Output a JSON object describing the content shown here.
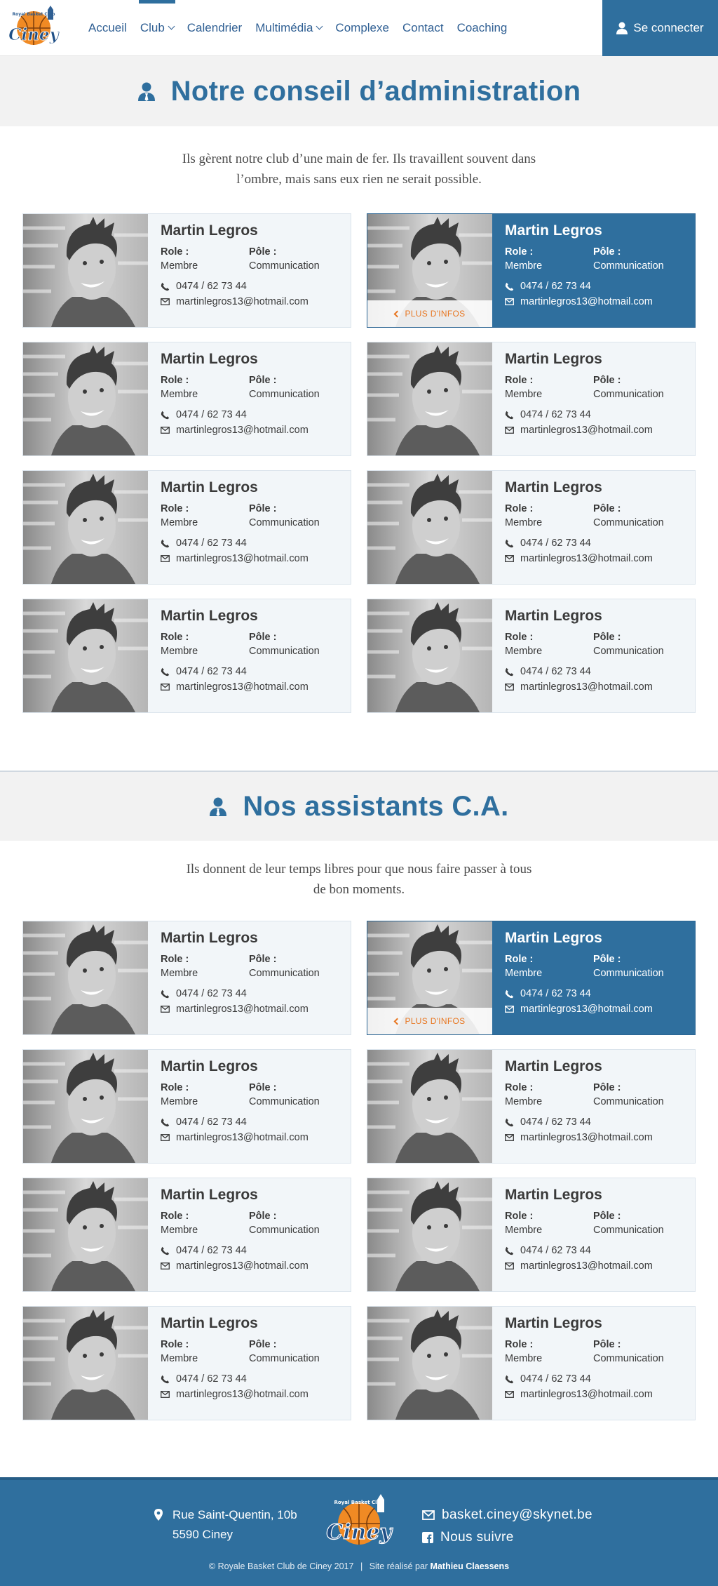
{
  "brand": {
    "logo_script": "Ciney",
    "logo_arc": "Royal Basket Club"
  },
  "nav": {
    "items": [
      {
        "label": "Accueil",
        "dropdown": false,
        "active": false
      },
      {
        "label": "Club",
        "dropdown": true,
        "active": true
      },
      {
        "label": "Calendrier",
        "dropdown": false,
        "active": false
      },
      {
        "label": "Multimédia",
        "dropdown": true,
        "active": false
      },
      {
        "label": "Complexe",
        "dropdown": false,
        "active": false
      },
      {
        "label": "Contact",
        "dropdown": false,
        "active": false
      },
      {
        "label": "Coaching",
        "dropdown": false,
        "active": false
      }
    ],
    "login_label": "Se connecter"
  },
  "sections": [
    {
      "title": "Notre conseil d’administration",
      "intro_line1": "Ils gèrent notre club d’une main de fer. Ils travaillent souvent dans",
      "intro_line2": "l’ombre, mais sans eux rien ne serait possible.",
      "members": [
        {
          "name": "Martin Legros",
          "role": "Membre",
          "pole": "Communication",
          "phone": "0474 / 62 73 44",
          "email": "martinlegros13@hotmail.com",
          "highlighted": false
        },
        {
          "name": "Martin Legros",
          "role": "Membre",
          "pole": "Communication",
          "phone": "0474 / 62 73 44",
          "email": "martinlegros13@hotmail.com",
          "highlighted": true
        },
        {
          "name": "Martin Legros",
          "role": "Membre",
          "pole": "Communication",
          "phone": "0474 / 62 73 44",
          "email": "martinlegros13@hotmail.com",
          "highlighted": false
        },
        {
          "name": "Martin Legros",
          "role": "Membre",
          "pole": "Communication",
          "phone": "0474 / 62 73 44",
          "email": "martinlegros13@hotmail.com",
          "highlighted": false
        },
        {
          "name": "Martin Legros",
          "role": "Membre",
          "pole": "Communication",
          "phone": "0474 / 62 73 44",
          "email": "martinlegros13@hotmail.com",
          "highlighted": false
        },
        {
          "name": "Martin Legros",
          "role": "Membre",
          "pole": "Communication",
          "phone": "0474 / 62 73 44",
          "email": "martinlegros13@hotmail.com",
          "highlighted": false
        },
        {
          "name": "Martin Legros",
          "role": "Membre",
          "pole": "Communication",
          "phone": "0474 / 62 73 44",
          "email": "martinlegros13@hotmail.com",
          "highlighted": false
        },
        {
          "name": "Martin Legros",
          "role": "Membre",
          "pole": "Communication",
          "phone": "0474 / 62 73 44",
          "email": "martinlegros13@hotmail.com",
          "highlighted": false
        }
      ]
    },
    {
      "title": "Nos assistants C.A.",
      "intro_line1": "Ils donnent de leur temps libres pour que nous faire passer à  tous",
      "intro_line2": "de bon moments.",
      "members": [
        {
          "name": "Martin Legros",
          "role": "Membre",
          "pole": "Communication",
          "phone": "0474 / 62 73 44",
          "email": "martinlegros13@hotmail.com",
          "highlighted": false
        },
        {
          "name": "Martin Legros",
          "role": "Membre",
          "pole": "Communication",
          "phone": "0474 / 62 73 44",
          "email": "martinlegros13@hotmail.com",
          "highlighted": true
        },
        {
          "name": "Martin Legros",
          "role": "Membre",
          "pole": "Communication",
          "phone": "0474 / 62 73 44",
          "email": "martinlegros13@hotmail.com",
          "highlighted": false
        },
        {
          "name": "Martin Legros",
          "role": "Membre",
          "pole": "Communication",
          "phone": "0474 / 62 73 44",
          "email": "martinlegros13@hotmail.com",
          "highlighted": false
        },
        {
          "name": "Martin Legros",
          "role": "Membre",
          "pole": "Communication",
          "phone": "0474 / 62 73 44",
          "email": "martinlegros13@hotmail.com",
          "highlighted": false
        },
        {
          "name": "Martin Legros",
          "role": "Membre",
          "pole": "Communication",
          "phone": "0474 / 62 73 44",
          "email": "martinlegros13@hotmail.com",
          "highlighted": false
        },
        {
          "name": "Martin Legros",
          "role": "Membre",
          "pole": "Communication",
          "phone": "0474 / 62 73 44",
          "email": "martinlegros13@hotmail.com",
          "highlighted": false
        },
        {
          "name": "Martin Legros",
          "role": "Membre",
          "pole": "Communication",
          "phone": "0474 / 62 73 44",
          "email": "martinlegros13@hotmail.com",
          "highlighted": false
        }
      ]
    }
  ],
  "card_labels": {
    "role": "Role :",
    "pole": "Pôle :",
    "more_info": "PLUS D'INFOS"
  },
  "footer": {
    "address_line1": "Rue Saint-Quentin, 10b",
    "address_line2": "5590 Ciney",
    "email": "basket.ciney@skynet.be",
    "social": "Nous suivre",
    "copyright": "© Royale Basket Club de Ciney 2017",
    "separator": "|",
    "credit_prefix": "Site réalisé par",
    "credit_author": "Mathieu Claessens"
  },
  "colors": {
    "primary": "#2f6f9e",
    "nav_text": "#2f5f93",
    "accent": "#e87722",
    "banner_bg": "#f2f2f2",
    "card_bg": "#f2f6f9"
  }
}
